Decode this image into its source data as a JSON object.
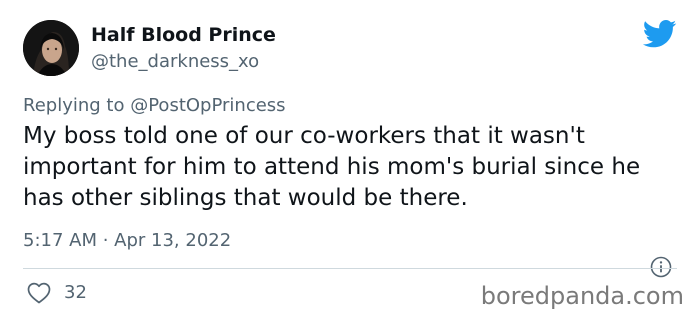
{
  "tweet": {
    "author_name": "Half Blood Prince",
    "author_handle": "@the_darkness_xo",
    "reply_prefix": "Replying to",
    "reply_to": "@PostOpPrincess",
    "text": "My boss told one of our co-workers that it wasn't important for him to attend his mom's burial since he has other siblings that would be there.",
    "timestamp": "5:17 AM · Apr 13, 2022",
    "like_count": "32"
  },
  "watermark": "boredpanda.com",
  "icons": {
    "platform": "twitter-bird-icon",
    "info": "info-icon",
    "like": "heart-icon"
  },
  "colors": {
    "twitter_blue": "#1d9bf0",
    "text_primary": "#0f1419",
    "text_secondary": "#536471",
    "divider": "#cfd9de"
  }
}
